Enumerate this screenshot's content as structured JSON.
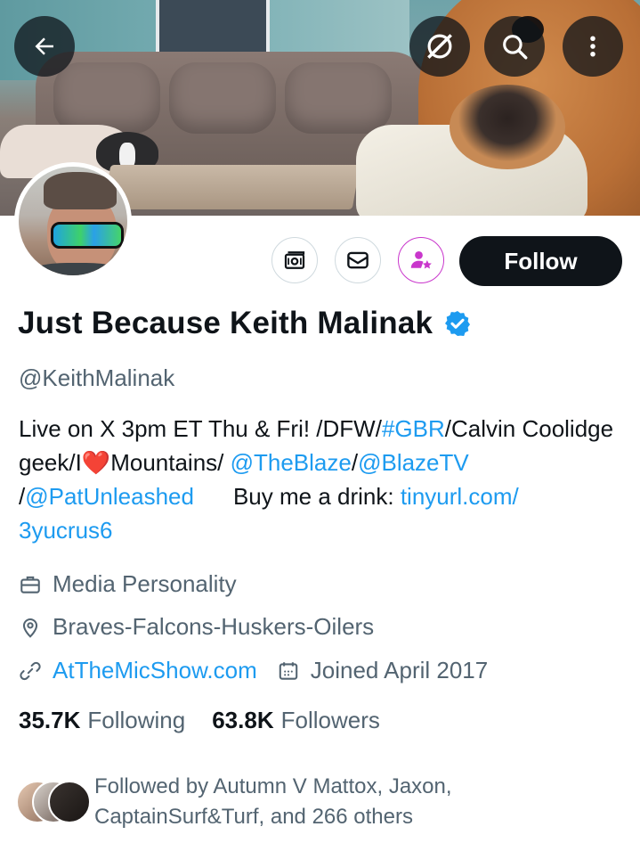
{
  "header": {
    "back_icon": "arrow-left-icon",
    "grok_icon": "slash-circle-icon",
    "search_icon": "search-icon",
    "more_icon": "more-vertical-icon"
  },
  "actions": {
    "subscribe_icon": "money-icon",
    "message_icon": "mail-icon",
    "creator_icon": "person-star-icon",
    "follow_label": "Follow"
  },
  "profile": {
    "name": "Just Because Keith Malinak",
    "handle": "@KeithMalinak",
    "verified_color": "#1d9bf0"
  },
  "bio": {
    "p1": "Live on X 3pm ET Thu & Fri! /DFW/",
    "hashtag": "#GBR",
    "p2": "/Calvin Coolidge geek/I",
    "heart": "❤️",
    "p3": "Mountains/ ",
    "mention1": "@TheBlaze",
    "sep1": "/",
    "mention2": "@BlazeTV",
    "sep2": "/",
    "mention3": "@PatUnleashed",
    "p4": "Buy me a drink: ",
    "url": "tinyurl.com/3yucrus6"
  },
  "meta": {
    "category": "Media Personality",
    "location": "Braves-Falcons-Huskers-Oilers",
    "website": "AtTheMicShow.com",
    "joined": "Joined April 2017"
  },
  "stats": {
    "following_count": "35.7K",
    "following_label": "Following",
    "followers_count": "63.8K",
    "followers_label": "Followers"
  },
  "followed_by": {
    "text": "Followed by Autumn V Mattox, Jaxon, CaptainSurf&Turf, and 266 others"
  },
  "colors": {
    "accent": "#1d9bf0",
    "text_primary": "#0f1419",
    "text_secondary": "#536471",
    "heart": "#f91880",
    "creator_purple": "#c936cc"
  }
}
